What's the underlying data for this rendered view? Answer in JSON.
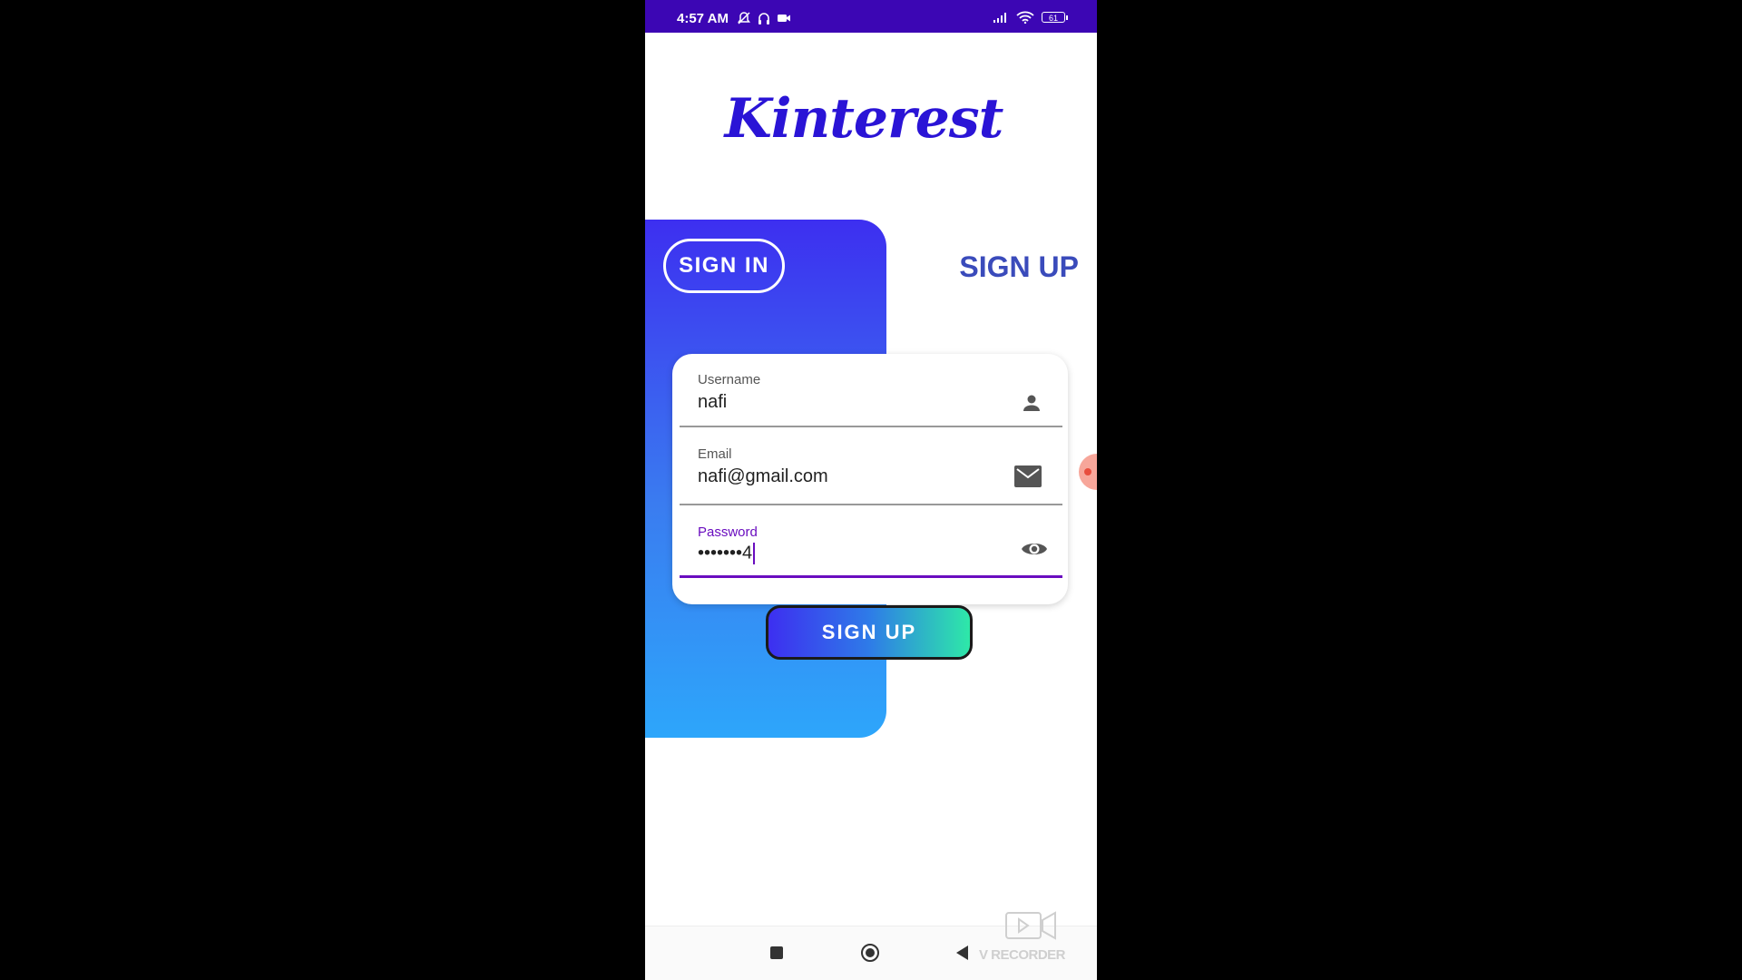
{
  "status_bar": {
    "time": "4:57 AM",
    "battery": "61",
    "bg_color": "#3c06b4",
    "icons_left": [
      "mute-icon",
      "headset-icon",
      "video-record-icon"
    ],
    "icons_right": [
      "signal-icon",
      "wifi-icon",
      "battery-icon"
    ]
  },
  "app": {
    "logo_text": "Kinterest",
    "brand_color": "#2a14d6"
  },
  "tabs": {
    "sign_in": "SIGN IN",
    "sign_up": "SIGN UP"
  },
  "form": {
    "username": {
      "label": "Username",
      "value": "nafi",
      "icon": "person-icon"
    },
    "email": {
      "label": "Email",
      "value": "nafi@gmail.com",
      "icon": "mail-icon"
    },
    "password": {
      "label": "Password",
      "value": "•••••••4",
      "icon": "eye-icon",
      "focused": true
    }
  },
  "submit_label": "SIGN UP",
  "watermark": "V RECORDER"
}
